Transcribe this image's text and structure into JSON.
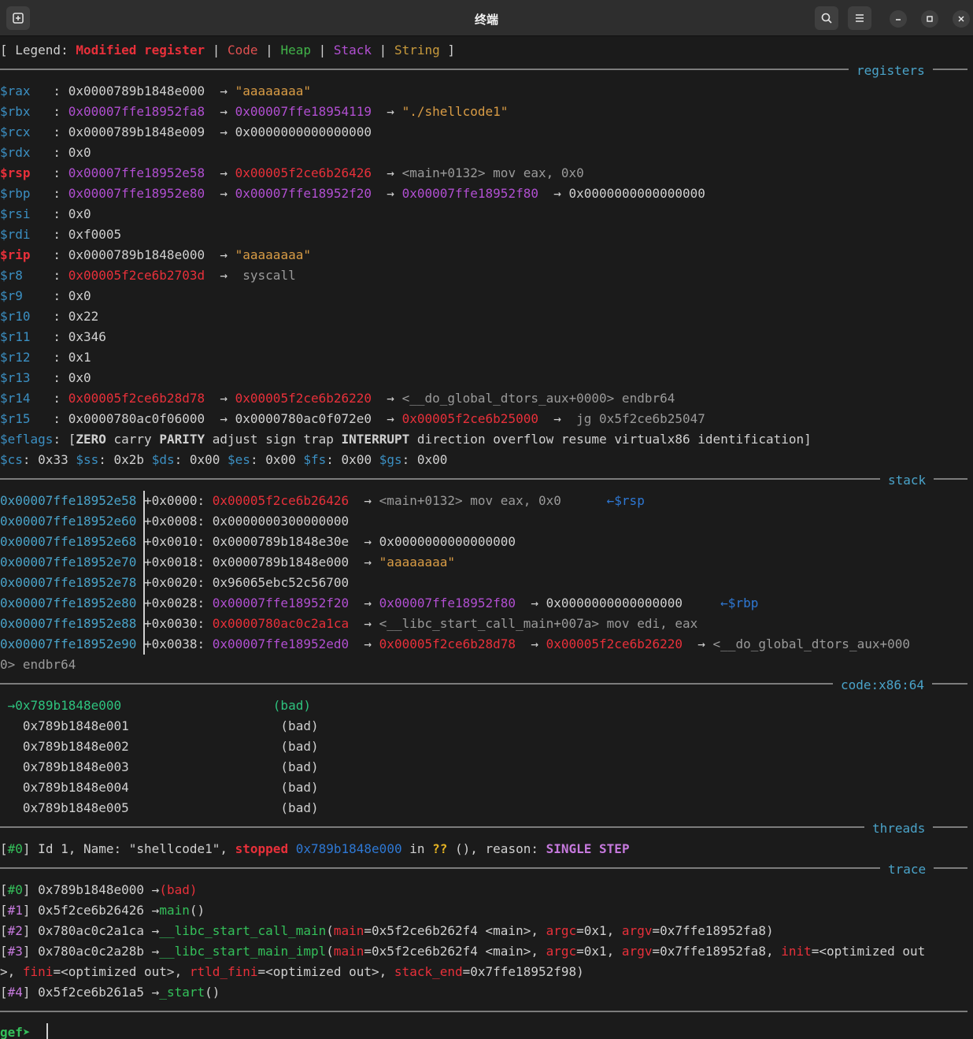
{
  "window": {
    "title": "终端"
  },
  "legend": {
    "open": "[ Legend: ",
    "modified": "Modified register",
    "sep": " | ",
    "code": "Code",
    "heap": "Heap",
    "stack": "Stack",
    "string": "String",
    "close": " ]"
  },
  "sections": {
    "registers": "registers",
    "stack": "stack",
    "code": "code:x86:64",
    "threads": "threads",
    "trace": "trace"
  },
  "arrow": "→",
  "registers": {
    "rax": {
      "name": "$rax",
      "v1": "0x0000789b1848e000",
      "v2": "\"aaaaaaaa\""
    },
    "rbx": {
      "name": "$rbx",
      "v1": "0x00007ffe18952fa8",
      "v2": "0x00007ffe18954119",
      "v3": "\"./shellcode1\""
    },
    "rcx": {
      "name": "$rcx",
      "v1": "0x0000789b1848e009",
      "v2": "0x0000000000000000"
    },
    "rdx": {
      "name": "$rdx",
      "v1": "0x0"
    },
    "rsp": {
      "name": "$rsp",
      "v1": "0x00007ffe18952e58",
      "v2": "0x00005f2ce6b26426",
      "v3": "<main+0132> mov eax, 0x0"
    },
    "rbp": {
      "name": "$rbp",
      "v1": "0x00007ffe18952e80",
      "v2": "0x00007ffe18952f20",
      "v3": "0x00007ffe18952f80",
      "v4": "0x0000000000000000"
    },
    "rsi": {
      "name": "$rsi",
      "v1": "0x0"
    },
    "rdi": {
      "name": "$rdi",
      "v1": "0xf0005"
    },
    "rip": {
      "name": "$rip",
      "v1": "0x0000789b1848e000",
      "v2": "\"aaaaaaaa\""
    },
    "r8": {
      "name": "$r8",
      "v1": "0x00005f2ce6b2703d",
      "v2": " syscall"
    },
    "r9": {
      "name": "$r9",
      "v1": "0x0"
    },
    "r10": {
      "name": "$r10",
      "v1": "0x22"
    },
    "r11": {
      "name": "$r11",
      "v1": "0x346"
    },
    "r12": {
      "name": "$r12",
      "v1": "0x1"
    },
    "r13": {
      "name": "$r13",
      "v1": "0x0"
    },
    "r14": {
      "name": "$r14",
      "v1": "0x00005f2ce6b28d78",
      "v2": "0x00005f2ce6b26220",
      "v3": "<__do_global_dtors_aux+0000> endbr64"
    },
    "r15": {
      "name": "$r15",
      "v1": "0x0000780ac0f06000",
      "v2": "0x0000780ac0f072e0",
      "v3": "0x00005f2ce6b25000",
      "v4": " jg 0x5f2ce6b25047"
    },
    "eflags": {
      "name": "$eflags",
      "open": "[",
      "zero": "ZERO",
      "carry": "carry",
      "parity": "PARITY",
      "mid1": "adjust sign trap",
      "interrupt": "INTERRUPT",
      "rest": "direction overflow resume virtualx86 identification",
      "close": "]"
    },
    "segs": [
      {
        "name": "$cs",
        "val": "0x33"
      },
      {
        "name": "$ss",
        "val": "0x2b"
      },
      {
        "name": "$ds",
        "val": "0x00"
      },
      {
        "name": "$es",
        "val": "0x00"
      },
      {
        "name": "$fs",
        "val": "0x00"
      },
      {
        "name": "$gs",
        "val": "0x00"
      }
    ]
  },
  "stack": [
    {
      "addr": "0x00007ffe18952e58",
      "off": "+0x0000:",
      "v1": "0x00005f2ce6b26426",
      "v2": "<main+0132> mov eax, 0x0",
      "tag": "←$rsp"
    },
    {
      "addr": "0x00007ffe18952e60",
      "off": "+0x0008:",
      "v1": "0x0000000300000000"
    },
    {
      "addr": "0x00007ffe18952e68",
      "off": "+0x0010:",
      "v1": "0x0000789b1848e30e",
      "v2": "0x0000000000000000"
    },
    {
      "addr": "0x00007ffe18952e70",
      "off": "+0x0018:",
      "v1": "0x0000789b1848e000",
      "v2": "\"aaaaaaaa\""
    },
    {
      "addr": "0x00007ffe18952e78",
      "off": "+0x0020:",
      "v1": "0x96065ebc52c56700"
    },
    {
      "addr": "0x00007ffe18952e80",
      "off": "+0x0028:",
      "v1": "0x00007ffe18952f20",
      "v2": "0x00007ffe18952f80",
      "v3": "0x0000000000000000",
      "tag": "←$rbp"
    },
    {
      "addr": "0x00007ffe18952e88",
      "off": "+0x0030:",
      "v1": "0x0000780ac0c2a1ca",
      "v2": "<__libc_start_call_main+007a> mov edi, eax"
    },
    {
      "addr": "0x00007ffe18952e90",
      "off": "+0x0038:",
      "v1": "0x00007ffe18952ed0",
      "v2": "0x00005f2ce6b28d78",
      "v3": "0x00005f2ce6b26220",
      "v4": "<__do_global_dtors_aux+000",
      "wrap": "0> endbr64"
    }
  ],
  "code": [
    {
      "addr": "0x789b1848e000",
      "ins": "(bad)",
      "current": true
    },
    {
      "addr": "0x789b1848e001",
      "ins": "(bad)"
    },
    {
      "addr": "0x789b1848e002",
      "ins": "(bad)"
    },
    {
      "addr": "0x789b1848e003",
      "ins": "(bad)"
    },
    {
      "addr": "0x789b1848e004",
      "ins": "(bad)"
    },
    {
      "addr": "0x789b1848e005",
      "ins": "(bad)"
    }
  ],
  "threads": {
    "idx": "#0",
    "pre": " Id 1, Name: \"shellcode1\", ",
    "state": "stopped",
    "addr": "0x789b1848e000",
    "in": " in ",
    "func": "??",
    "mid": " (), reason: ",
    "reason": "SINGLE STEP"
  },
  "trace": {
    "t0": {
      "idx": "#0",
      "addr": "0x789b1848e000",
      "func": "(bad)"
    },
    "t1": {
      "idx": "#1",
      "addr": "0x5f2ce6b26426",
      "func": "main",
      "args": "()"
    },
    "t2": {
      "idx": "#2",
      "addr": "0x780ac0c2a1ca",
      "func": "__libc_start_call_main",
      "k1": "main",
      "v1": "=0x5f2ce6b262f4 <main>, ",
      "k2": "argc",
      "v2": "=0x1, ",
      "k3": "argv",
      "v3": "=0x7ffe18952fa8)"
    },
    "t3": {
      "idx": "#3",
      "addr": "0x780ac0c2a28b",
      "func": "__libc_start_main_impl",
      "k1": "main",
      "v1": "=0x5f2ce6b262f4 <main>, ",
      "k2": "argc",
      "v2": "=0x1, ",
      "k3": "argv",
      "v3": "=0x7ffe18952fa8, ",
      "k4": "init",
      "v4": "=<optimized out",
      "w0": ">, ",
      "k5": "fini",
      "v5": "=<optimized out>, ",
      "k6": "rtld_fini",
      "v6": "=<optimized out>, ",
      "k7": "stack_end",
      "v7": "=0x7ffe18952f98)"
    },
    "t4": {
      "idx": "#4",
      "addr": "0x5f2ce6b261a5",
      "func": "_start",
      "args": "()"
    }
  },
  "prompt": "gef➤ "
}
